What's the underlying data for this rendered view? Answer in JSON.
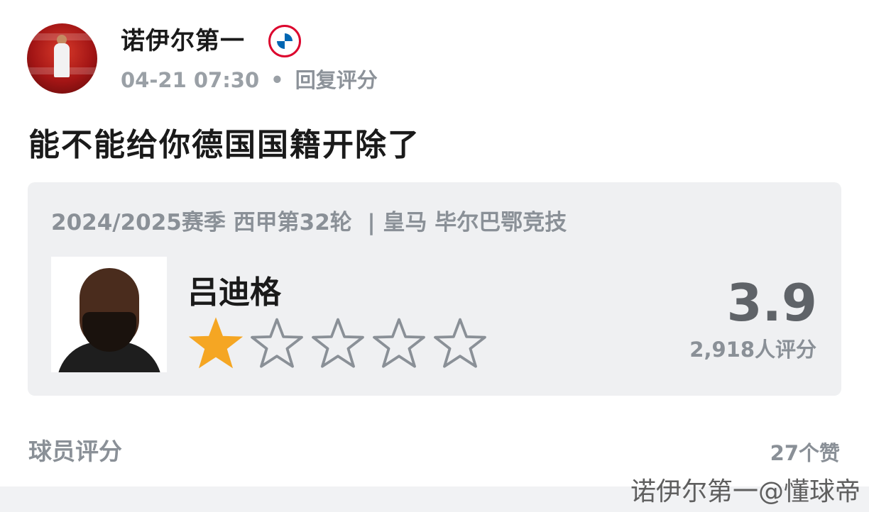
{
  "user": {
    "name": "诺伊尔第一",
    "badge_icon": "fc-bayern-munich-badge-icon",
    "avatar_icon": "arsenal-fan-avatar"
  },
  "meta": {
    "time": "04-21 07:30",
    "separator": "•",
    "reply_label": "回复评分"
  },
  "comment": {
    "text": "能不能给你德国国籍开除了"
  },
  "rating_card": {
    "match": "2024/2025赛季 西甲第32轮  | 皇马 毕尔巴鄂竞技",
    "player_name": "吕迪格",
    "stars_filled": 1,
    "stars_total": 5,
    "star_fill_color": "#F5A623",
    "star_empty_color": "#8A9097",
    "score": "3.9",
    "rating_count": "2,918人评分"
  },
  "footer": {
    "section_label": "球员评分",
    "likes": "27个赞"
  },
  "watermark": {
    "text": "诺伊尔第一@懂球帝"
  }
}
